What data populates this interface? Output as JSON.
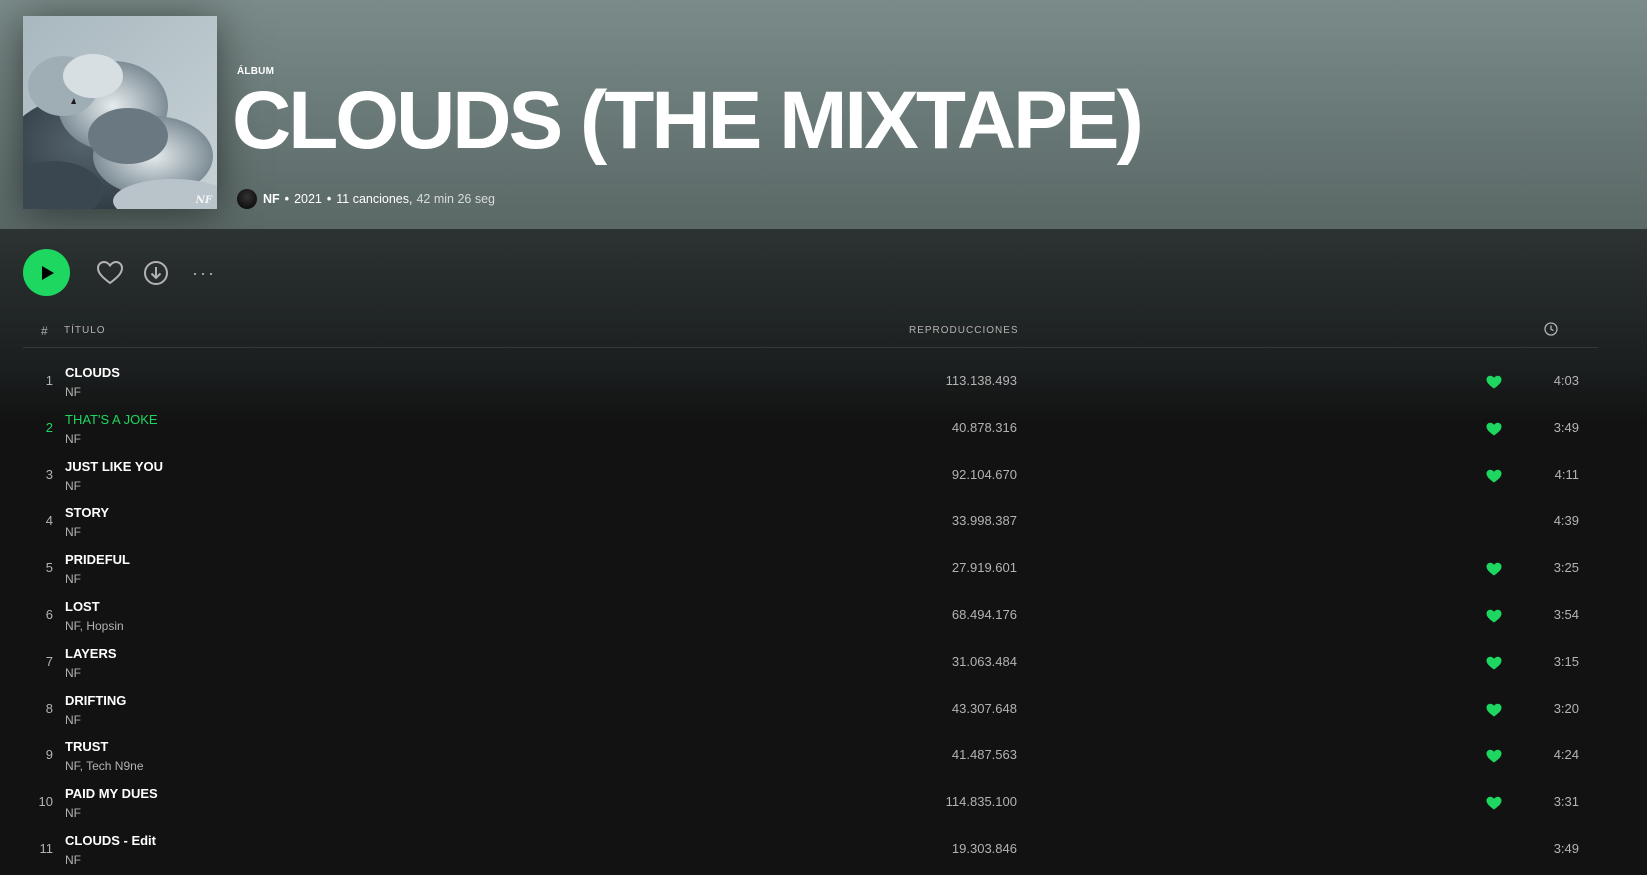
{
  "header": {
    "type_label": "ÁLBUM",
    "title": "CLOUDS (THE MIXTAPE)",
    "cover_signature": "NF",
    "artist": "NF",
    "year": "2021",
    "songs": "11 canciones,",
    "duration": "42 min 26 seg"
  },
  "actions": {
    "play_icon": "play-icon",
    "like_icon": "heart-outline-icon",
    "download_icon": "download-icon",
    "more_label": "···"
  },
  "table": {
    "col_num": "#",
    "col_title": "TÍTULO",
    "col_plays": "REPRODUCCIONES",
    "col_duration_icon": "clock-icon"
  },
  "tracks": [
    {
      "num": "1",
      "title": "CLOUDS",
      "artist": "NF",
      "plays": "113.138.493",
      "liked": true,
      "duration": "4:03",
      "playing": false
    },
    {
      "num": "2",
      "title": "THAT'S A JOKE",
      "artist": "NF",
      "plays": "40.878.316",
      "liked": true,
      "duration": "3:49",
      "playing": true
    },
    {
      "num": "3",
      "title": "JUST LIKE YOU",
      "artist": "NF",
      "plays": "92.104.670",
      "liked": true,
      "duration": "4:11",
      "playing": false
    },
    {
      "num": "4",
      "title": "STORY",
      "artist": "NF",
      "plays": "33.998.387",
      "liked": false,
      "duration": "4:39",
      "playing": false
    },
    {
      "num": "5",
      "title": "PRIDEFUL",
      "artist": "NF",
      "plays": "27.919.601",
      "liked": true,
      "duration": "3:25",
      "playing": false
    },
    {
      "num": "6",
      "title": "LOST",
      "artist": "NF, Hopsin",
      "plays": "68.494.176",
      "liked": true,
      "duration": "3:54",
      "playing": false
    },
    {
      "num": "7",
      "title": "LAYERS",
      "artist": "NF",
      "plays": "31.063.484",
      "liked": true,
      "duration": "3:15",
      "playing": false
    },
    {
      "num": "8",
      "title": "DRIFTING",
      "artist": "NF",
      "plays": "43.307.648",
      "liked": true,
      "duration": "3:20",
      "playing": false
    },
    {
      "num": "9",
      "title": "TRUST",
      "artist": "NF, Tech N9ne",
      "plays": "41.487.563",
      "liked": true,
      "duration": "4:24",
      "playing": false
    },
    {
      "num": "10",
      "title": "PAID MY DUES",
      "artist": "NF",
      "plays": "114.835.100",
      "liked": true,
      "duration": "3:31",
      "playing": false
    },
    {
      "num": "11",
      "title": "CLOUDS - Edit",
      "artist": "NF",
      "plays": "19.303.846",
      "liked": false,
      "duration": "3:49",
      "playing": false
    }
  ],
  "colors": {
    "accent": "#1ed760",
    "background": "#121212",
    "header_tint": "#6b7b79",
    "muted_text": "#b3b3b3"
  }
}
